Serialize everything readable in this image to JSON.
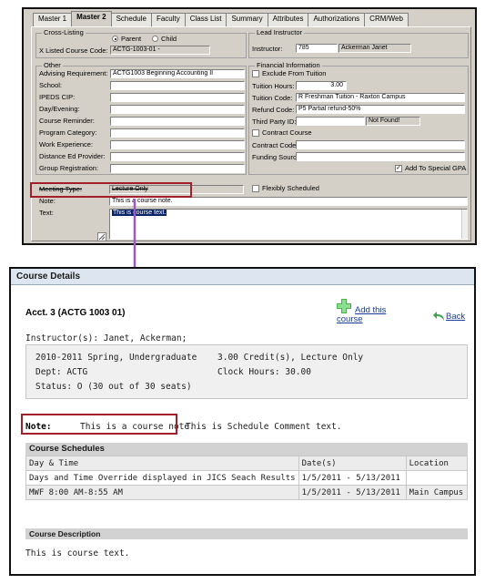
{
  "admin_form": {
    "tabs": [
      "Master 1",
      "Master 2",
      "Schedule",
      "Faculty",
      "Class List",
      "Summary",
      "Attributes",
      "Authorizations",
      "CRM/Web"
    ],
    "active_tab": "Master 2",
    "cross_listing": {
      "group_title": "Cross-Listing",
      "parent_label": "Parent",
      "child_label": "Child",
      "x_listed_label": "X Listed Course Code:",
      "x_listed_value": "ACTG-1003-01 -"
    },
    "lead_instructor": {
      "group_title": "Lead Instructor",
      "label": "Instructor:",
      "id": "785",
      "name": "Ackerman Janet"
    },
    "other": {
      "group_title": "Other",
      "fields": [
        {
          "label": "Advising Requirement:",
          "value": "ACTG1003   Beginning Accounting II"
        },
        {
          "label": "School:",
          "value": ""
        },
        {
          "label": "IPEDS CIP:",
          "value": ""
        },
        {
          "label": "Day/Evening:",
          "value": ""
        },
        {
          "label": "Course Reminder:",
          "value": ""
        },
        {
          "label": "Program Category:",
          "value": ""
        },
        {
          "label": "Work Experience:",
          "value": ""
        },
        {
          "label": "Distance Ed Provider:",
          "value": ""
        },
        {
          "label": "Group Registration:",
          "value": ""
        }
      ]
    },
    "financial": {
      "group_title": "Financial Information",
      "exclude_label": "Exclude From Tuition",
      "tuition_hours_label": "Tuition Hours:",
      "tuition_hours_value": "3.00",
      "tuition_code_label": "Tuition Code:",
      "tuition_code_value": "R    Freshman Tuition - Raxton Campus",
      "refund_code_label": "Refund Code:",
      "refund_code_value": "P5   Partial refund-50%",
      "third_party_label": "Third Party ID:",
      "third_party_value": "Not Found!",
      "contract_course_label": "Contract Course",
      "contract_code_label": "Contract Code:",
      "funding_source_label": "Funding Source:",
      "special_gpa_label": "Add To Special GPA",
      "special_gpa_check": "✓"
    },
    "meeting_type_label": "Meeting Type:",
    "meeting_type_value": "Lecture Only",
    "flexibly_scheduled_label": "Flexibly Scheduled",
    "note_label": "Note:",
    "note_value": "This is a course note.",
    "text_label": "Text:",
    "text_value": "This is course text."
  },
  "course_details": {
    "header": "Course Details",
    "course_title": "Acct. 3 (ACTG 1003 01)",
    "add_course_label": "Add this course",
    "back_label": "Back",
    "instructors": "Instructor(s): Janet, Ackerman;",
    "term": "2010-2011 Spring, Undergraduate",
    "credits": "3.00 Credit(s), Lecture Only",
    "dept": "Dept: ACTG",
    "clock_hours": "Clock Hours: 30.00",
    "status": "Status: O (30 out of 30 seats)",
    "note_label": "Note:",
    "note_text": "This is a course note.",
    "schedule_comment": "This is Schedule Comment text.",
    "schedules_title": "Course Schedules",
    "schedule_columns": [
      "Day & Time",
      "Date(s)",
      "Location"
    ],
    "schedule_rows": [
      [
        "Days and Time Override displayed in JICS Seach Results",
        "1/5/2011 - 5/13/2011",
        ""
      ],
      [
        "MWF 8:00 AM-8:55 AM",
        "1/5/2011 - 5/13/2011",
        "Main Campus"
      ]
    ],
    "description_title": "Course Description",
    "description_text": "This is course text."
  },
  "colors": {
    "highlight_box": "#a3202a",
    "connector_arrow": "#9b59c9",
    "link": "#1a3d9a",
    "header_band": "#dde6f0"
  }
}
